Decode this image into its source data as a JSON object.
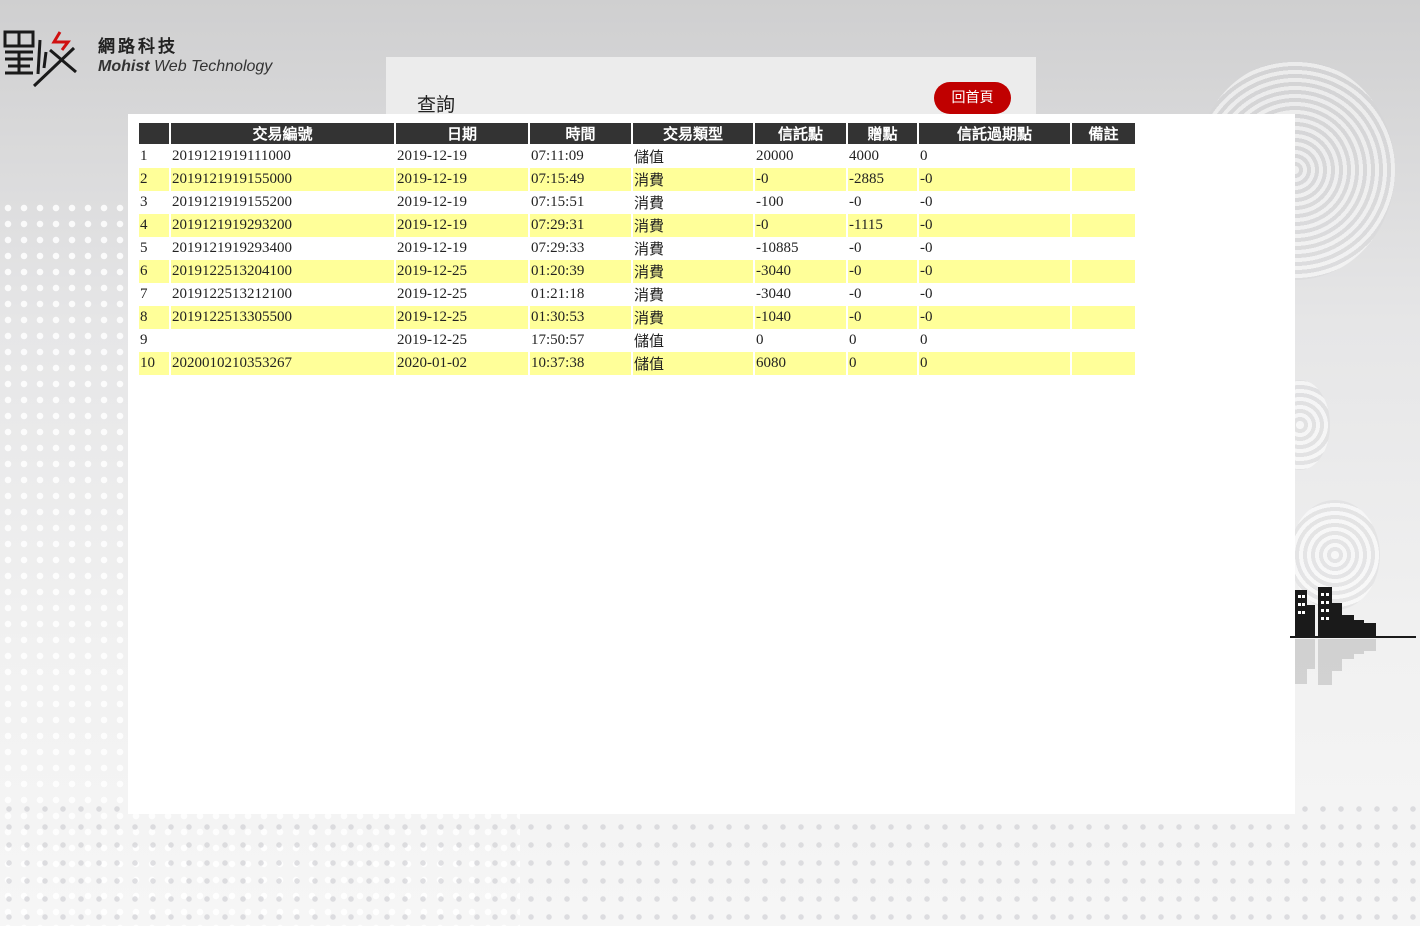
{
  "brand": {
    "name_cn": "網路科技",
    "name_en_bold": "Mohist",
    "name_en_rest": " Web Technology"
  },
  "query": {
    "title": "查詢",
    "home_button": "回首頁"
  },
  "colors": {
    "header_bg": "#333333",
    "alt_row": "#ffff99",
    "home_button": "#c00000"
  },
  "table": {
    "headers": [
      "",
      "交易編號",
      "日期",
      "時間",
      "交易類型",
      "信託點",
      "贈點",
      "信託過期點",
      "備註"
    ],
    "rows": [
      [
        "1",
        "2019121919111000",
        "2019-12-19",
        "07:11:09",
        "儲值",
        "20000",
        "4000",
        "0",
        ""
      ],
      [
        "2",
        "2019121919155000",
        "2019-12-19",
        "07:15:49",
        "消費",
        "-0",
        "-2885",
        "-0",
        ""
      ],
      [
        "3",
        "2019121919155200",
        "2019-12-19",
        "07:15:51",
        "消費",
        "-100",
        "-0",
        "-0",
        ""
      ],
      [
        "4",
        "2019121919293200",
        "2019-12-19",
        "07:29:31",
        "消費",
        "-0",
        "-1115",
        "-0",
        ""
      ],
      [
        "5",
        "2019121919293400",
        "2019-12-19",
        "07:29:33",
        "消費",
        "-10885",
        "-0",
        "-0",
        ""
      ],
      [
        "6",
        "2019122513204100",
        "2019-12-25",
        "01:20:39",
        "消費",
        "-3040",
        "-0",
        "-0",
        ""
      ],
      [
        "7",
        "2019122513212100",
        "2019-12-25",
        "01:21:18",
        "消費",
        "-3040",
        "-0",
        "-0",
        ""
      ],
      [
        "8",
        "2019122513305500",
        "2019-12-25",
        "01:30:53",
        "消費",
        "-1040",
        "-0",
        "-0",
        ""
      ],
      [
        "9",
        "",
        "2019-12-25",
        "17:50:57",
        "儲值",
        "0",
        "0",
        "0",
        ""
      ],
      [
        "10",
        "2020010210353267",
        "2020-01-02",
        "10:37:38",
        "儲值",
        "6080",
        "0",
        "0",
        ""
      ]
    ]
  }
}
